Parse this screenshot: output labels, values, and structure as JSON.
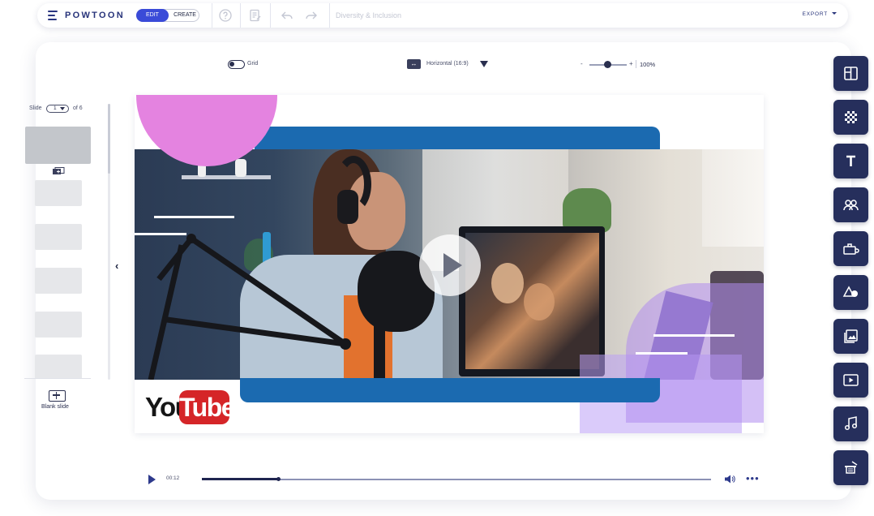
{
  "app": {
    "logo": "POWTOON",
    "mode_edit": "EDIT",
    "mode_create": "CREATE",
    "project_name": "Diversity & Inclusion",
    "export_label": "EXPORT"
  },
  "toolbar": {
    "grid_label": "Grid",
    "orientation_label": "Horizontal (16:9)",
    "zoom_minus": "-",
    "zoom_plus": "+",
    "zoom_value": "100%"
  },
  "slides": {
    "label": "Slide",
    "current": "1",
    "of_label": "of 6",
    "blank_slide_label": "Blank slide"
  },
  "canvas": {
    "brand_you": "You",
    "brand_tube": "Tube"
  },
  "player": {
    "time": "00:12",
    "progress_fraction": 0.15
  },
  "colors": {
    "accent": "#3a4bd8",
    "rail": "#262f5c",
    "bar_blue": "#1b6ab0",
    "pink": "#e483e0",
    "purple": "#bca0f6",
    "youtube_red": "#d52528"
  },
  "rail_icons": [
    "layout-icon",
    "background-icon",
    "text-icon",
    "characters-icon",
    "props-icon",
    "shapes-icon",
    "media-icon",
    "video-icon",
    "music-icon",
    "magic-hat-icon"
  ]
}
